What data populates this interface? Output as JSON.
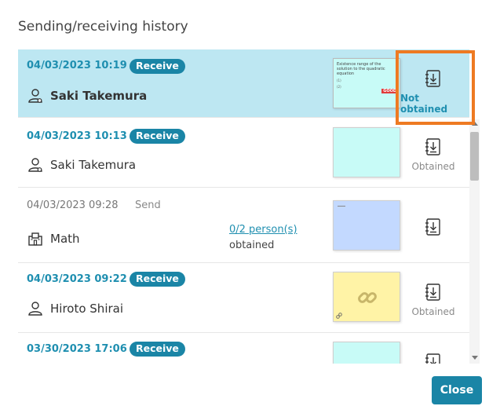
{
  "dialog": {
    "title": "Sending/receiving history",
    "close_label": "Close"
  },
  "colors": {
    "accent": "#1a85a6",
    "date_text": "#1f8fb0",
    "selected_row": "#bde7f2",
    "highlight_border": "#ee7a22"
  },
  "history": [
    {
      "date": "04/03/2023 10:19",
      "type": "Receive",
      "name": "Saki Takemura",
      "icon": "student-icon",
      "thumbnail_color": "#c8fbf7",
      "thumbnail_text": "Existence range of the solution to the quadratic equation",
      "thumbnail_line1": "(1)",
      "thumbnail_line2": "(2)",
      "thumbnail_badge": "GOOD",
      "status": "Not obtained"
    },
    {
      "date": "04/03/2023 10:13",
      "type": "Receive",
      "name": "Saki Takemura",
      "icon": "student-icon",
      "thumbnail_color": "#c8fbf7",
      "status": "Obtained"
    },
    {
      "date": "04/03/2023 09:28",
      "type": "Send",
      "name": "Math",
      "icon": "class-icon",
      "obtained_link": "0/2 person(s)",
      "obtained_text": "obtained",
      "thumbnail_color": "#c3d9ff",
      "status": ""
    },
    {
      "date": "04/03/2023 09:22",
      "type": "Receive",
      "name": "Hiroto Shirai",
      "icon": "person-icon",
      "thumbnail_color": "#fff3a6",
      "status": "Obtained"
    },
    {
      "date": "03/30/2023 17:06",
      "type": "Receive",
      "name": "",
      "thumbnail_color": "#c8fbf7",
      "status": ""
    }
  ]
}
